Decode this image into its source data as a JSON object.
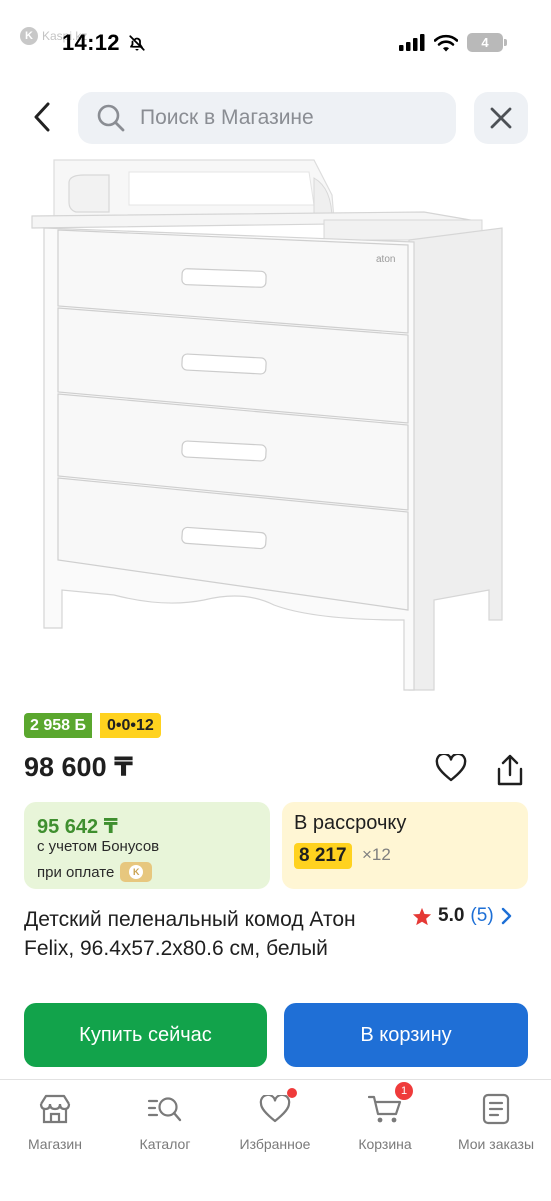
{
  "status_bar": {
    "source": "Kaspi.kz",
    "source_logo_letter": "K",
    "time": "14:12",
    "battery_level": "4",
    "icons": [
      "bell-off-icon",
      "signal-icon",
      "wifi-icon",
      "battery-icon"
    ]
  },
  "header": {
    "back_icon": "chevron-left-icon",
    "search_placeholder": "Поиск в Магазине",
    "search_icon": "search-icon",
    "close_icon": "close-icon"
  },
  "product": {
    "image": {
      "description_icon": "dresser-image",
      "brand_mark": "aton"
    },
    "bonus_badge": "2 958 Б",
    "installment_badge": "0•0•12",
    "price": "98 600 ₸",
    "favorite_icon": "heart-icon",
    "share_icon": "share-icon",
    "bonus_card": {
      "price": "95 642 ₸",
      "line1": "с учетом Бонусов",
      "line2": "при оплате",
      "coin_letter": "K"
    },
    "installment_card": {
      "title": "В рассрочку",
      "amount": "8 217",
      "multiplier": "×12"
    },
    "title": "Детский пеленальный комод Атон Felix, 96.4x57.2x80.6 см, белый",
    "rating": {
      "score": "5.0",
      "count": "(5)",
      "star_icon": "star-icon",
      "arrow_icon": "chevron-right-icon"
    }
  },
  "actions": {
    "buy_now": "Купить сейчас",
    "add_to_cart": "В корзину"
  },
  "bottom_nav": {
    "items": [
      {
        "label": "Магазин",
        "icon": "store-icon"
      },
      {
        "label": "Каталог",
        "icon": "catalog-icon"
      },
      {
        "label": "Избранное",
        "icon": "heart-icon"
      },
      {
        "label": "Корзина",
        "icon": "cart-icon",
        "badge": "1"
      },
      {
        "label": "Мои заказы",
        "icon": "orders-icon"
      }
    ]
  },
  "colors": {
    "green": "#12a34b",
    "blue": "#1f6fd6",
    "yellow": "#ffd21f",
    "bonus_green": "#5aa72e",
    "red": "#ef3b3b"
  }
}
